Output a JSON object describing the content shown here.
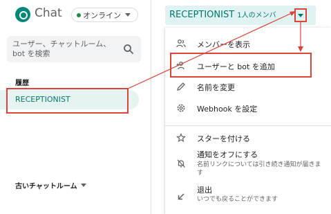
{
  "app": {
    "title": "Chat"
  },
  "status": {
    "label": "オンライン"
  },
  "search": {
    "placeholder": "ユーザー、チャットルーム、bot を検索"
  },
  "sidebar": {
    "section_label": "履歴",
    "active_room": "RECEPTIONIST",
    "old_rooms_label": "古いチャットルーム"
  },
  "room_header": {
    "name": "RECEPTIONIST",
    "members": "1人のメンバ"
  },
  "menu": {
    "items": [
      {
        "label": "メンバーを表示",
        "icon": "people-icon"
      },
      {
        "label": "ユーザーと bot を追加",
        "icon": "person-add-icon"
      },
      {
        "label": "名前を変更",
        "icon": "pencil-icon"
      },
      {
        "label": "Webhook を設定",
        "icon": "settings-icon"
      },
      {
        "label": "スターを付ける",
        "icon": "star-icon"
      },
      {
        "label": "通知をオフにする",
        "sub": "名前リンクについては引き続き通知が届きます",
        "icon": "bell-off-icon"
      },
      {
        "label": "退出",
        "sub": "いつでも戻ることができます",
        "icon": "leave-icon"
      }
    ]
  },
  "colors": {
    "accent": "#00796b",
    "annotation": "#db4437"
  }
}
